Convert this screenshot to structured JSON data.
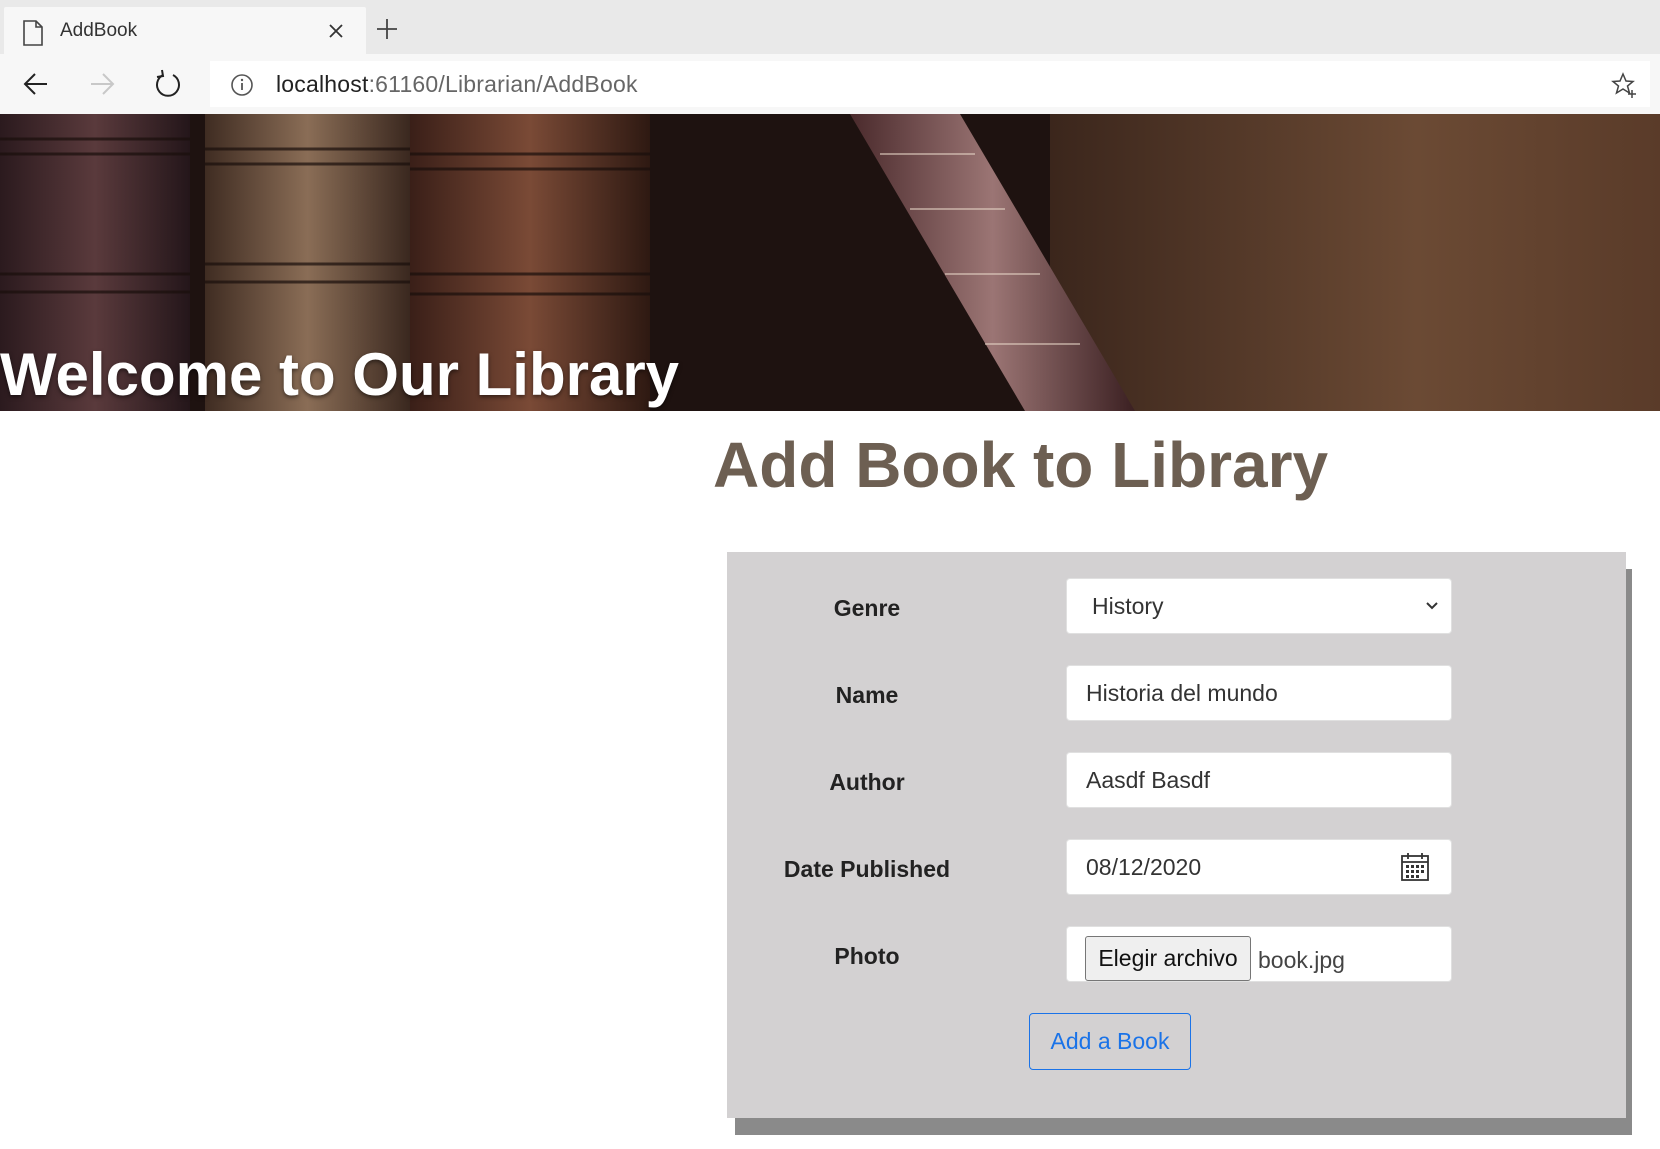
{
  "browser": {
    "tab_title": "AddBook",
    "url_host": "localhost",
    "url_path": ":61160/Librarian/AddBook"
  },
  "banner": {
    "title": "Welcome to Our Library"
  },
  "page": {
    "heading": "Add Book to Library"
  },
  "form": {
    "genre": {
      "label": "Genre",
      "value": "History"
    },
    "name": {
      "label": "Name",
      "value": "Historia del mundo"
    },
    "author": {
      "label": "Author",
      "value": "Aasdf Basdf"
    },
    "date_published": {
      "label": "Date Published",
      "value": "08/12/2020"
    },
    "photo": {
      "label": "Photo",
      "button_label": "Elegir archivo",
      "file_name": "book.jpg"
    },
    "submit_label": "Add a Book"
  },
  "colors": {
    "heading": "#6d5f52",
    "panel": "#d3d1d2",
    "panel_shadow": "#8a8a8a",
    "accent": "#1a73e8"
  },
  "icons": [
    "page-icon",
    "close-icon",
    "plus-icon",
    "back-arrow-icon",
    "forward-arrow-icon",
    "reload-icon",
    "info-icon",
    "favorite-star-icon",
    "chevron-down-icon",
    "calendar-icon"
  ]
}
